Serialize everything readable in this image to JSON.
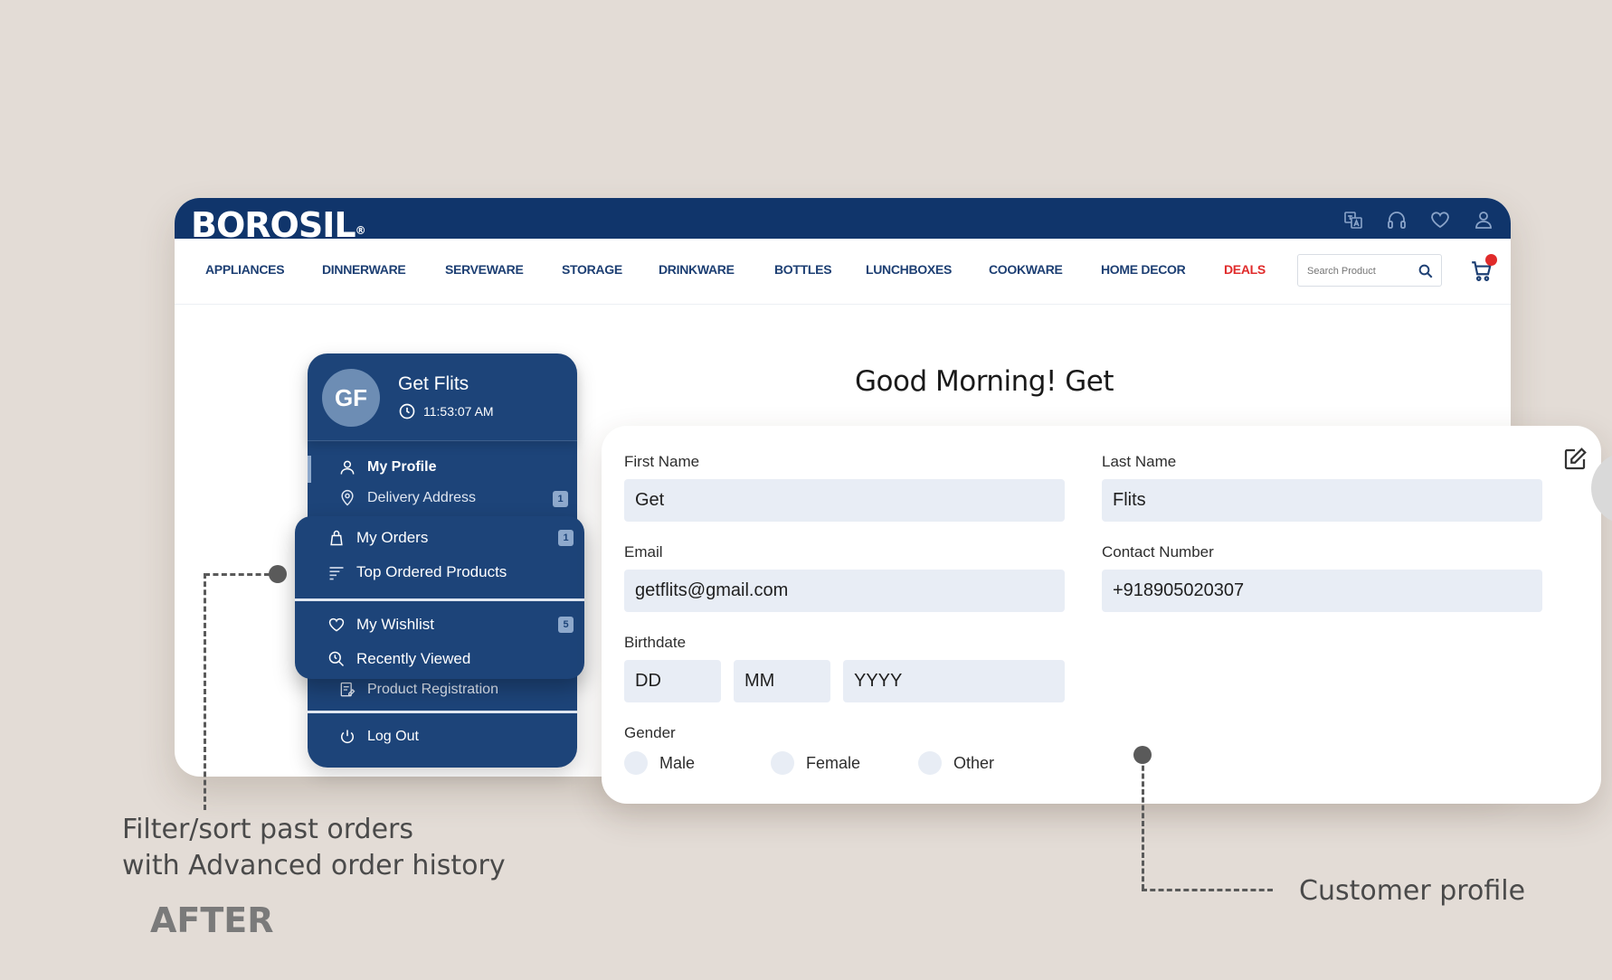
{
  "brand": {
    "logo": "BOROSIL",
    "mark": "®"
  },
  "top_icons": [
    "translate-icon",
    "headset-icon",
    "heart-icon",
    "user-icon"
  ],
  "nav": {
    "items": [
      "APPLIANCES",
      "DINNERWARE",
      "SERVEWARE",
      "STORAGE",
      "DRINKWARE",
      "BOTTLES",
      "LUNCHBOXES",
      "COOKWARE",
      "HOME DECOR",
      "DEALS"
    ],
    "search_placeholder": "Search Product"
  },
  "greeting": "Good Morning! Get",
  "sidebar": {
    "initials": "GF",
    "name": "Get Flits",
    "time": "11:53:07 AM",
    "items": {
      "my_profile": "My Profile",
      "delivery_address": "Delivery Address",
      "delivery_address_badge": "1",
      "my_orders": "My Orders",
      "my_orders_badge": "1",
      "top_ordered": "Top Ordered Products",
      "my_wishlist": "My Wishlist",
      "my_wishlist_badge": "5",
      "recently_viewed": "Recently Viewed",
      "product_registration": "Product Registration",
      "log_out": "Log Out"
    }
  },
  "profile": {
    "first_name_label": "First Name",
    "first_name": "Get",
    "last_name_label": "Last Name",
    "last_name": "Flits",
    "email_label": "Email",
    "email": "getflits@gmail.com",
    "contact_label": "Contact Number",
    "contact": "+918905020307",
    "birthdate_label": "Birthdate",
    "dd": "DD",
    "mm": "MM",
    "yyyy": "YYYY",
    "gender_label": "Gender",
    "genders": [
      "Male",
      "Female",
      "Other"
    ]
  },
  "annotations": {
    "left_line1": "Filter/sort past orders",
    "left_line2": "with Advanced order history",
    "right": "Customer profile",
    "after": "AFTER"
  },
  "colors": {
    "navy": "#10356b",
    "panel": "#1d4479",
    "deals": "#e02b2b",
    "input_bg": "#e8edf5",
    "background": "#e3dcd6"
  }
}
